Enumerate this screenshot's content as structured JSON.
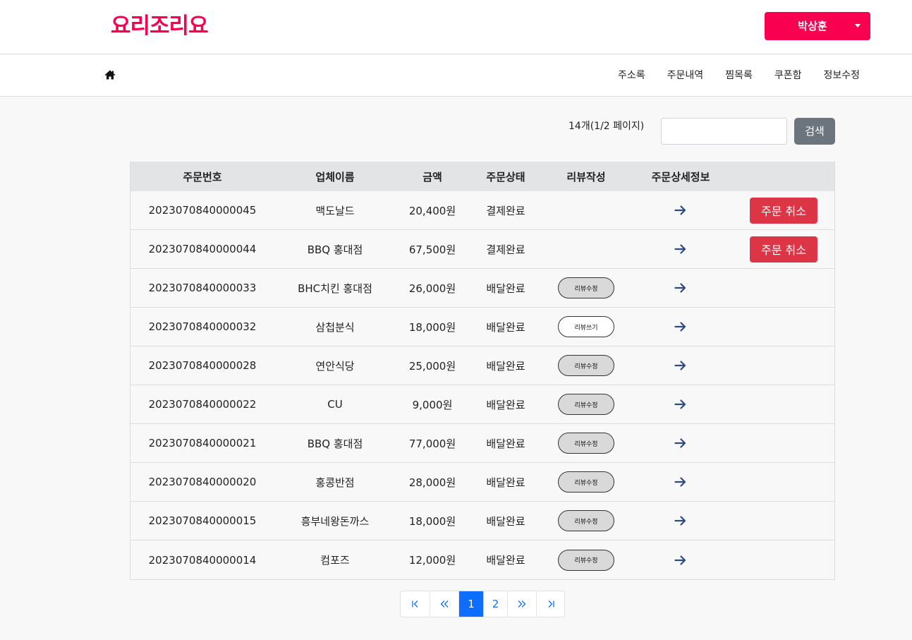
{
  "header": {
    "logo": "요리조리요",
    "user_name": "박상훈"
  },
  "nav": {
    "links": [
      "주소록",
      "주문내역",
      "찜목록",
      "쿠폰함",
      "정보수정"
    ]
  },
  "search": {
    "info": "14개(1/2 페이지)",
    "value": "",
    "button_label": "검색"
  },
  "table": {
    "headers": [
      "주문번호",
      "업체이름",
      "금액",
      "주문상태",
      "리뷰작성",
      "주문상세정보",
      ""
    ],
    "rows": [
      {
        "order_no": "2023070840000045",
        "store": "맥도날드",
        "amount": "20,400원",
        "status": "결제완료",
        "review": "",
        "review_type": "none",
        "action": "주문 취소"
      },
      {
        "order_no": "2023070840000044",
        "store": "BBQ 홍대점",
        "amount": "67,500원",
        "status": "결제완료",
        "review": "",
        "review_type": "none",
        "action": "주문 취소"
      },
      {
        "order_no": "2023070840000033",
        "store": "BHC치킨 홍대점",
        "amount": "26,000원",
        "status": "배달완료",
        "review": "리뷰수정",
        "review_type": "edit",
        "action": ""
      },
      {
        "order_no": "2023070840000032",
        "store": "삼첩분식",
        "amount": "18,000원",
        "status": "배달완료",
        "review": "리뷰쓰기",
        "review_type": "write",
        "action": ""
      },
      {
        "order_no": "2023070840000028",
        "store": "연안식당",
        "amount": "25,000원",
        "status": "배달완료",
        "review": "리뷰수정",
        "review_type": "edit",
        "action": ""
      },
      {
        "order_no": "2023070840000022",
        "store": "CU",
        "amount": "9,000원",
        "status": "배달완료",
        "review": "리뷰수정",
        "review_type": "edit",
        "action": ""
      },
      {
        "order_no": "2023070840000021",
        "store": "BBQ 홍대점",
        "amount": "77,000원",
        "status": "배달완료",
        "review": "리뷰수정",
        "review_type": "edit",
        "action": ""
      },
      {
        "order_no": "2023070840000020",
        "store": "홍콩반점",
        "amount": "28,000원",
        "status": "배달완료",
        "review": "리뷰수정",
        "review_type": "edit",
        "action": ""
      },
      {
        "order_no": "2023070840000015",
        "store": "흥부네왕돈까스",
        "amount": "18,000원",
        "status": "배달완료",
        "review": "리뷰수정",
        "review_type": "edit",
        "action": ""
      },
      {
        "order_no": "2023070840000014",
        "store": "컴포즈",
        "amount": "12,000원",
        "status": "배달완료",
        "review": "리뷰수정",
        "review_type": "edit",
        "action": ""
      }
    ]
  },
  "pagination": {
    "pages": [
      "1",
      "2"
    ],
    "active": "1"
  },
  "colors": {
    "brand": "#fa0050",
    "danger": "#dc3545",
    "primary": "#0d6efd",
    "secondary": "#6c757d",
    "arrow": "#2e4a86"
  }
}
